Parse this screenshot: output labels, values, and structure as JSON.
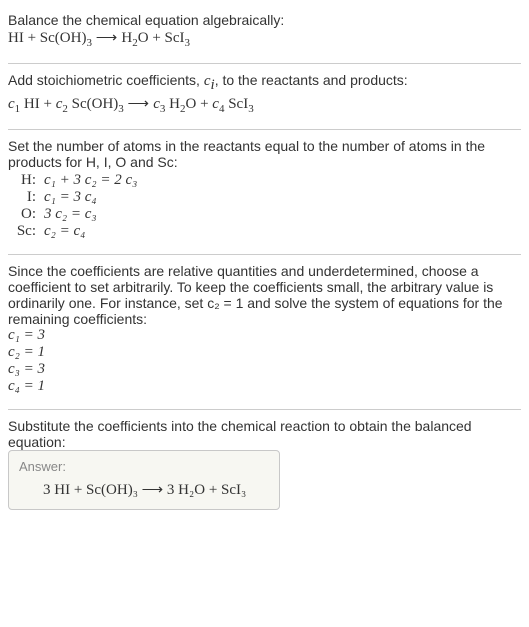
{
  "s1": {
    "text": "Balance the chemical equation algebraically:",
    "eq_lhs1": "HI",
    "eq_lhs2": "Sc(OH)",
    "eq_lhs2_sub": "3",
    "eq_rhs1": "H",
    "eq_rhs1_sub": "2",
    "eq_rhs1b": "O",
    "eq_rhs2": "ScI",
    "eq_rhs2_sub": "3",
    "plus": " + ",
    "arrow": " ⟶ "
  },
  "s2": {
    "text1": "Add stoichiometric coefficients, ",
    "ci": "c",
    "ci_sub": "i",
    "text2": ", to the reactants and products:",
    "c1": "c",
    "c1s": "1",
    "p1": " HI",
    "c2": "c",
    "c2s": "2",
    "p2": " Sc(OH)",
    "p2_sub": "3",
    "c3": "c",
    "c3s": "3",
    "p3a": " H",
    "p3a_sub": "2",
    "p3b": "O",
    "c4": "c",
    "c4s": "4",
    "p4": " ScI",
    "p4_sub": "3"
  },
  "s3": {
    "text": "Set the number of atoms in the reactants equal to the number of atoms in the products for H, I, O and Sc:",
    "rows": [
      {
        "el": "H:",
        "lhs": "c₁ + 3 c₂ = 2 c₃"
      },
      {
        "el": "I:",
        "lhs": "c₁ = 3 c₄"
      },
      {
        "el": "O:",
        "lhs": "3 c₂ = c₃"
      },
      {
        "el": "Sc:",
        "lhs": "c₂ = c₄"
      }
    ]
  },
  "s4": {
    "text": "Since the coefficients are relative quantities and underdetermined, choose a coefficient to set arbitrarily. To keep the coefficients small, the arbitrary value is ordinarily one. For instance, set c₂ = 1 and solve the system of equations for the remaining coefficients:",
    "sol": [
      "c₁ = 3",
      "c₂ = 1",
      "c₃ = 3",
      "c₄ = 1"
    ]
  },
  "s5": {
    "text": "Substitute the coefficients into the chemical reaction to obtain the balanced equation:"
  },
  "answer": {
    "label": "Answer:",
    "eq": "3 HI + Sc(OH)₃  ⟶  3 H₂O + ScI₃"
  },
  "chart_data": {
    "type": "table",
    "title": "Balance HI + Sc(OH)3 -> H2O + ScI3",
    "unknowns": [
      "c1",
      "c2",
      "c3",
      "c4"
    ],
    "equations": {
      "H": "c1 + 3 c2 = 2 c3",
      "I": "c1 = 3 c4",
      "O": "3 c2 = c3",
      "Sc": "c2 = c4"
    },
    "solution": {
      "c1": 3,
      "c2": 1,
      "c3": 3,
      "c4": 1
    },
    "balanced": "3 HI + Sc(OH)3 -> 3 H2O + ScI3"
  }
}
